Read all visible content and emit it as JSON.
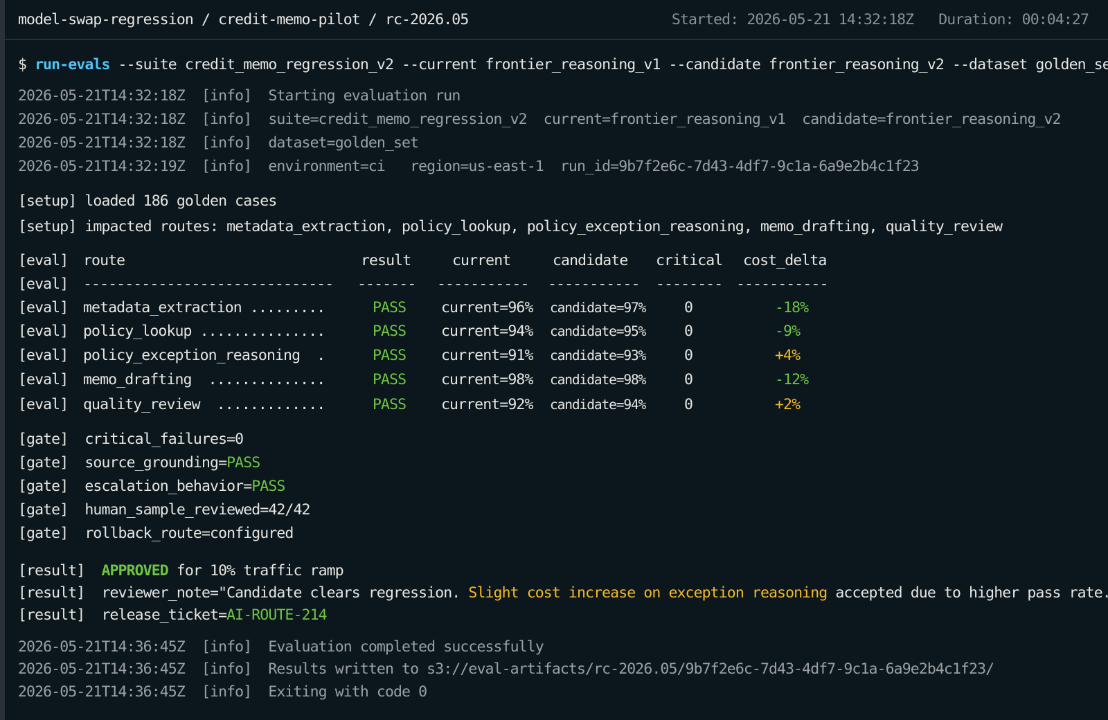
{
  "header": {
    "breadcrumb": "model-swap-regression / credit-memo-pilot / rc-2026.05",
    "started": "Started: 2026-05-21 14:32:18Z",
    "duration": "Duration: 00:04:27"
  },
  "command": {
    "prompt": "$",
    "program": "run-evals",
    "args": "--suite credit_memo_regression_v2 --current frontier_reasoning_v1 --candidate frontier_reasoning_v2 --dataset golden_set"
  },
  "start_logs": [
    {
      "ts": "2026-05-21T14:32:18Z",
      "level": "[info]",
      "msg": "Starting evaluation run"
    },
    {
      "ts": "2026-05-21T14:32:18Z",
      "level": "[info]",
      "msg": "suite=credit_memo_regression_v2  current=frontier_reasoning_v1  candidate=frontier_reasoning_v2"
    },
    {
      "ts": "2026-05-21T14:32:18Z",
      "level": "[info]",
      "msg": "dataset=golden_set"
    },
    {
      "ts": "2026-05-21T14:32:19Z",
      "level": "[info]",
      "msg": "environment=ci   region=us-east-1  run_id=9b7f2e6c-7d43-4df7-9c1a-6a9e2b4c1f23"
    }
  ],
  "setup": [
    {
      "tag": "[setup]",
      "msg": "loaded 186 golden cases"
    },
    {
      "tag": "[setup]",
      "msg": "impacted routes: metadata_extraction, policy_lookup, policy_exception_reasoning, memo_drafting, quality_review"
    }
  ],
  "eval": {
    "tag": "[eval]",
    "headers": {
      "route": "route",
      "result": "result",
      "current": "current",
      "candidate": "candidate",
      "critical": "critical",
      "cost_delta": "cost_delta"
    },
    "separators": {
      "route": "------------------------------",
      "result": "-------",
      "current": "-----------",
      "candidate": "-----------",
      "critical": "--------",
      "cost_delta": "-----------"
    },
    "rows": [
      {
        "route": "metadata_extraction .........",
        "result": "PASS",
        "current": "current=96%",
        "candidate": "candidate=97%",
        "critical": "0",
        "cost_delta": "-18%",
        "cost_color": "green"
      },
      {
        "route": "policy_lookup ...............",
        "result": "PASS",
        "current": "current=94%",
        "candidate": "candidate=95%",
        "critical": "0",
        "cost_delta": "-9%",
        "cost_color": "green"
      },
      {
        "route": "policy_exception_reasoning  .",
        "result": "PASS",
        "current": "current=91%",
        "candidate": "candidate=93%",
        "critical": "0",
        "cost_delta": "+4%",
        "cost_color": "amber"
      },
      {
        "route": "memo_drafting  ..............",
        "result": "PASS",
        "current": "current=98%",
        "candidate": "candidate=98%",
        "critical": "0",
        "cost_delta": "-12%",
        "cost_color": "green"
      },
      {
        "route": "quality_review  .............",
        "result": "PASS",
        "current": "current=92%",
        "candidate": "candidate=94%",
        "critical": "0",
        "cost_delta": "+2%",
        "cost_color": "amber"
      }
    ]
  },
  "gate": {
    "tag": "[gate]",
    "lines": [
      {
        "key": "critical_failures=",
        "value": "0",
        "color": ""
      },
      {
        "key": "source_grounding=",
        "value": "PASS",
        "color": "green"
      },
      {
        "key": "escalation_behavior=",
        "value": "PASS",
        "color": "green"
      },
      {
        "key": "human_sample_reviewed=",
        "value": "42/42",
        "color": ""
      },
      {
        "key": "rollback_route=",
        "value": "configured",
        "color": ""
      }
    ]
  },
  "result": {
    "tag": "[result]",
    "approved_word": "APPROVED",
    "approved_rest": " for 10% traffic ramp",
    "note_prefix": "reviewer_note=\"Candidate clears regression. ",
    "note_highlight": "Slight cost increase on exception reasoning",
    "note_suffix": " accepted due to higher pass rate.\"",
    "ticket_key": "release_ticket=",
    "ticket_value": "AI-ROUTE-214"
  },
  "end_logs": [
    {
      "ts": "2026-05-21T14:36:45Z",
      "level": "[info]",
      "msg": "Evaluation completed successfully"
    },
    {
      "ts": "2026-05-21T14:36:45Z",
      "level": "[info]",
      "msg": "Results written to s3://eval-artifacts/rc-2026.05/9b7f2e6c-7d43-4df7-9c1a-6a9e2b4c1f23/"
    },
    {
      "ts": "2026-05-21T14:36:45Z",
      "level": "[info]",
      "msg": "Exiting with code 0"
    }
  ],
  "colors": {
    "background": "#0c171d",
    "green": "#6cc644",
    "amber": "#f4b928",
    "command": "#4fc3f7",
    "dim": "#9ba0a3"
  }
}
